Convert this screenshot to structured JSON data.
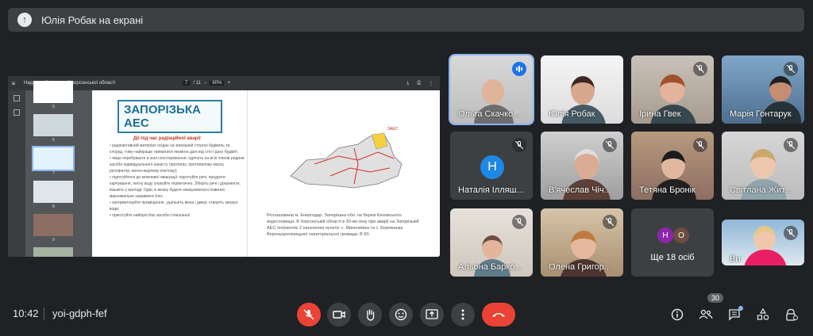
{
  "presenting_banner": {
    "icon": "present-icon",
    "text": "Юлія Робак на екрані"
  },
  "shared_screen": {
    "viewer": {
      "doc_title": "Надзвичайні ситуації херсонської області",
      "page_current": "7",
      "page_total": "/ 11",
      "zoom": "80%"
    },
    "thumb_numbers": [
      "5",
      "6",
      "7",
      "8",
      "9"
    ],
    "slide": {
      "heading": "ЗАПОРІЗЬКА АЕС",
      "subheading": "Дії під час радіаційної аварії",
      "bullets": [
        "радіоактивний матеріал осідає на зовнішній стороні будівель та споруд, тому найкраще триматися якомога далі від стін і даху будівлі;",
        "якщо перебуваєте в зоні спостереження: одягніть на всіх членів родини засоби індивідуального захисту (протигаз, протипилову маску, респіратор, ватно-марлеву пов'язку);",
        "підготуйтеся до можливої евакуації: підготуйте речі, продукти харчування, питну воду упакуйте герметично. Зберіть речі і документи, візьміть у вигляді. Одяг, в якому будете евакуюватися повинен максимально закривати тіло;",
        "загерметизуйте приміщення, ущільніть вікна і двері; створіть запаси води;",
        "приготуйте найпростіші засоби стикальної"
      ],
      "map_label": "ЗАЕС",
      "caption": "Розташована м. Енергодар, Запорізька обл. на березі Каховського водосховища. В Херсонській області в 30-км зону при аварії на Запорізькій АЕС потрапляє 2 населених пункти: с. Миколаївка та с. Бережанка Верхньорогачицької територіальної громади. В 50-"
    }
  },
  "participants": [
    {
      "name": "Ольга Скачко...",
      "mic": "speaking",
      "active": true
    },
    {
      "name": "Юлія Робак",
      "mic": "none"
    },
    {
      "name": "Ірина Гвек",
      "mic": "muted"
    },
    {
      "name": "Марія Гонтарук",
      "mic": "muted"
    },
    {
      "name": "Наталія Ілляш...",
      "mic": "muted",
      "avatar_letter": "Н",
      "avatar_color": "#1e88e5"
    },
    {
      "name": "В'ячеслав Чіч...",
      "mic": "muted"
    },
    {
      "name": "Тетяна Бронік",
      "mic": "muted"
    },
    {
      "name": "Світлана Жит...",
      "mic": "muted"
    },
    {
      "name": "Альона Барко...",
      "mic": "muted"
    },
    {
      "name": "Олена Григор...",
      "mic": "muted"
    },
    {
      "name": "Ви",
      "mic": "muted"
    }
  ],
  "more_tile": {
    "label": "Ще 18 осіб",
    "avatars": [
      {
        "letter": "Н",
        "color": "#8e24aa"
      },
      {
        "letter": "О",
        "color": "#6d4c41"
      }
    ]
  },
  "bottom_bar": {
    "time": "10:42",
    "meeting_code": "yoi-gdph-fef",
    "participant_count": "30",
    "controls": [
      "mic-off-icon",
      "camera-icon",
      "raise-hand-icon",
      "emoji-icon",
      "present-screen-icon",
      "more-options-icon",
      "hang-up-icon"
    ],
    "right_icons": [
      "info-icon",
      "people-icon",
      "chat-icon",
      "activities-icon",
      "host-controls-icon"
    ]
  },
  "colors": {
    "background": "#202124",
    "surface": "#3c4043",
    "accent": "#8ab4f8",
    "danger": "#ea4335",
    "speaking": "#1a73e8"
  }
}
